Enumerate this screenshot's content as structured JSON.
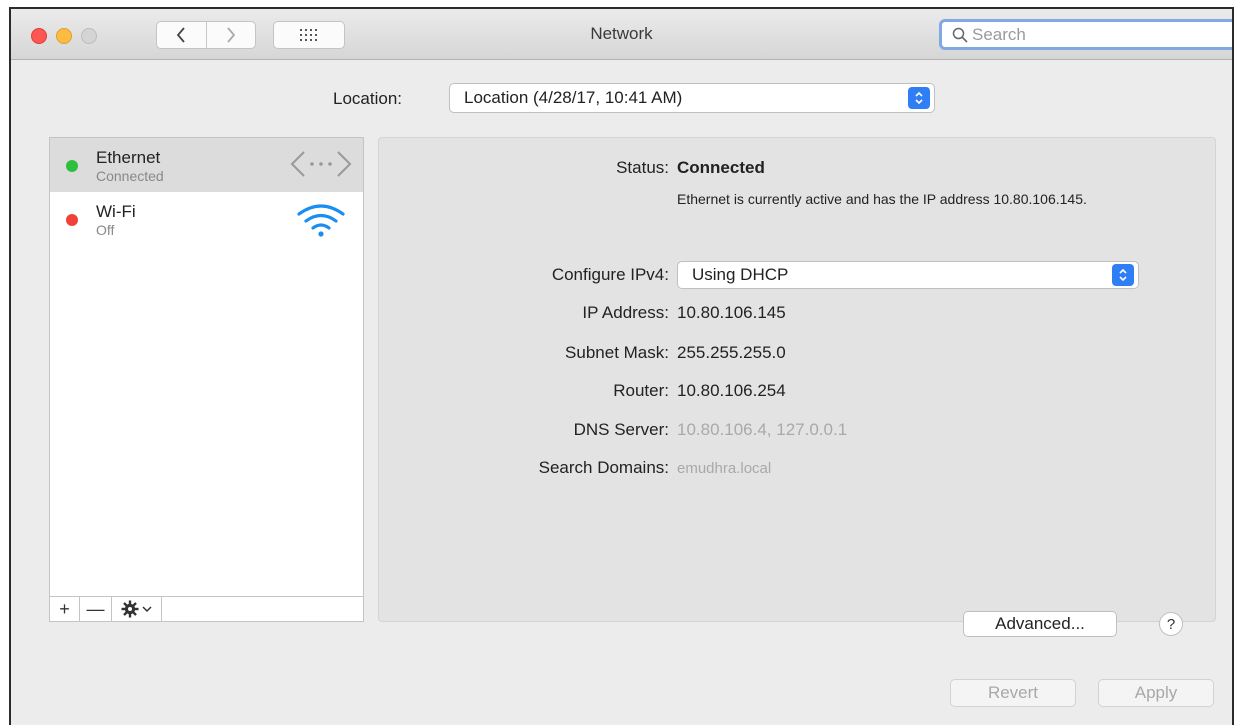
{
  "window": {
    "title": "Network",
    "search_placeholder": "Search"
  },
  "location": {
    "label": "Location:",
    "value": "Location (4/28/17, 10:41 AM)"
  },
  "services": [
    {
      "name": "Ethernet",
      "state": "Connected",
      "status_color": "#2fbf3f",
      "icon": "ethernet-icon",
      "selected": true
    },
    {
      "name": "Wi-Fi",
      "state": "Off",
      "status_color": "#f0423a",
      "icon": "wifi-icon",
      "selected": false
    }
  ],
  "sidebar_controls": {
    "add": "+",
    "remove": "—"
  },
  "details": {
    "status_label": "Status:",
    "status_value": "Connected",
    "status_description": "Ethernet is currently active and has the IP address 10.80.106.145.",
    "configure_ipv4_label": "Configure IPv4:",
    "configure_ipv4_value": "Using DHCP",
    "ip_address_label": "IP Address:",
    "ip_address_value": "10.80.106.145",
    "subnet_mask_label": "Subnet Mask:",
    "subnet_mask_value": "255.255.255.0",
    "router_label": "Router:",
    "router_value": "10.80.106.254",
    "dns_server_label": "DNS Server:",
    "dns_server_value": "10.80.106.4, 127.0.0.1",
    "search_domains_label": "Search Domains:",
    "search_domains_value": "emudhra.local",
    "advanced_label": "Advanced...",
    "help_label": "?"
  },
  "footer": {
    "revert_label": "Revert",
    "apply_label": "Apply"
  },
  "colors": {
    "accent": "#2f7ef5",
    "search_focus": "#80a8e4"
  }
}
